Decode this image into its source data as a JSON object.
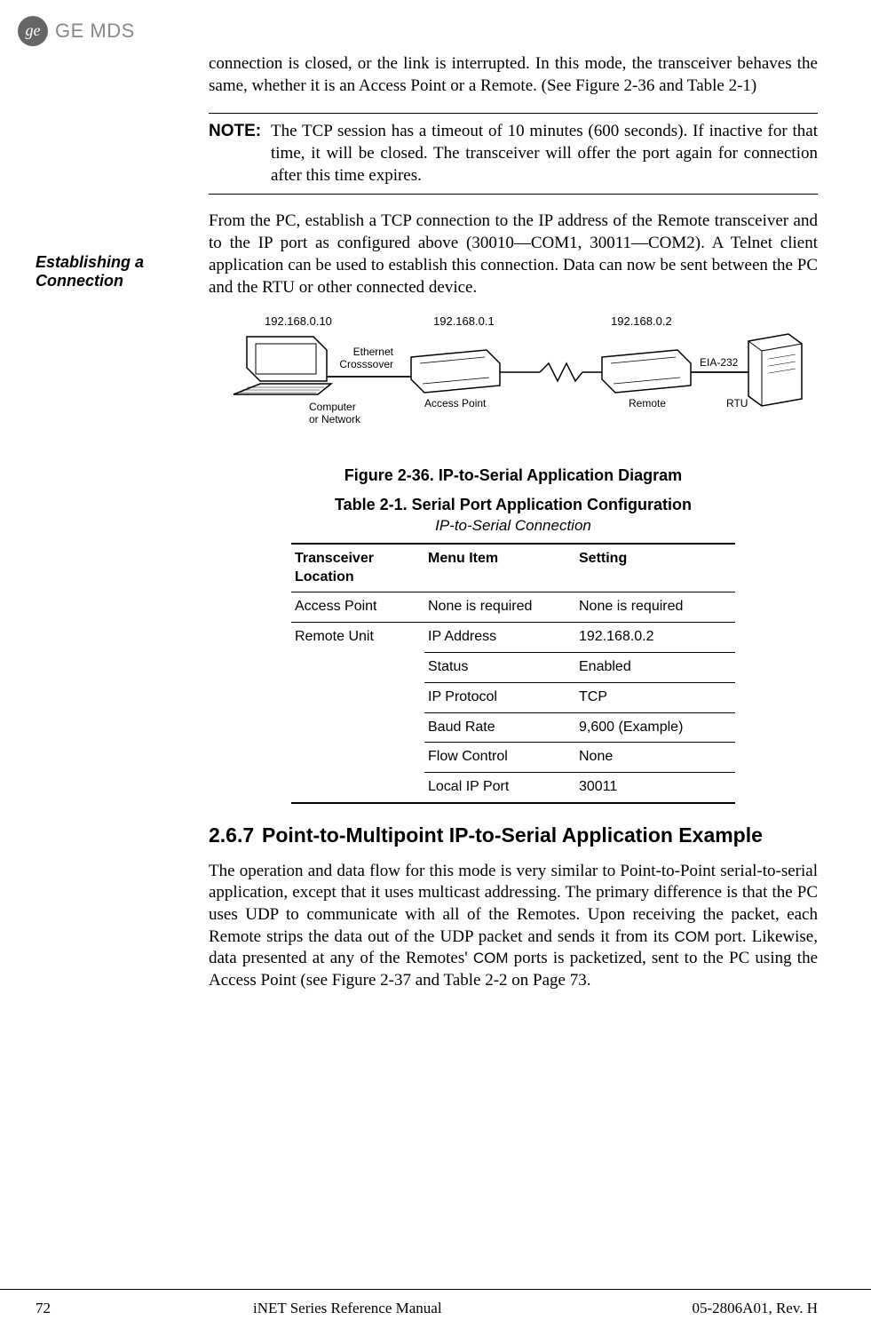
{
  "header": {
    "brand": "GE MDS"
  },
  "sidebar": {
    "margin_heading": "Establishing a Connection"
  },
  "body": {
    "para1": "connection is closed, or the link is interrupted. In this mode, the transceiver behaves the same, whether it is an Access Point or a Remote. (See Figure 2-36 and Table 2-1)",
    "note_label": "NOTE:",
    "note_text": "The TCP session has a timeout of 10 minutes (600 seconds). If inactive for that time, it will be closed. The transceiver will offer the port again for connection after this time expires.",
    "para2": "From the PC, establish a TCP connection to the IP address of the Remote transceiver and to the IP port as configured above (30010—COM1, 30011—COM2). A Telnet client application can be used to establish this connection. Data can now be sent between the PC and the RTU or other connected device."
  },
  "diagram": {
    "ip_pc": "192.168.0.10",
    "ip_ap": "192.168.0.1",
    "ip_remote": "192.168.0.2",
    "label_crossover_l1": "Ethernet",
    "label_crossover_l2": "Crosssover",
    "label_computer_l1": "Computer",
    "label_computer_l2": "or Network",
    "label_ap": "Access Point",
    "label_remote": "Remote",
    "label_eia": "EIA-232",
    "label_rtu": "RTU"
  },
  "figure_caption": "Figure 2-36. IP-to-Serial Application Diagram",
  "table": {
    "title": "Table 2-1. Serial Port Application Configuration",
    "subtitle": "IP-to-Serial Connection",
    "headers": {
      "col1": "Transceiver Location",
      "col2": "Menu Item",
      "col3": "Setting"
    },
    "rows": [
      {
        "c1": "Access Point",
        "c2": "None is required",
        "c3": "None is required"
      },
      {
        "c1": "Remote Unit",
        "c2": "IP Address",
        "c3": "192.168.0.2"
      },
      {
        "c1": "",
        "c2": "Status",
        "c3": "Enabled"
      },
      {
        "c1": "",
        "c2": "IP Protocol",
        "c3": "TCP"
      },
      {
        "c1": "",
        "c2": "Baud Rate",
        "c3": "9,600 (Example)"
      },
      {
        "c1": "",
        "c2": "Flow Control",
        "c3": "None"
      },
      {
        "c1": "",
        "c2": "Local IP Port",
        "c3": "30011"
      }
    ]
  },
  "section": {
    "number": "2.6.7",
    "title": "Point-to-Multipoint IP-to-Serial Application Example",
    "para_a": "The operation and data flow for this mode is very similar to Point-to-Point serial-to-serial application, except that it uses multicast addressing. The primary difference is that the PC uses UDP to communicate with all of the Remotes. Upon receiving the packet, each Remote strips the data out of the UDP packet and sends it from its ",
    "com1": "COM",
    "para_b": " port. Likewise, data presented at any of the Remotes' ",
    "com2": "COM",
    "para_c": " ports is packetized, sent to the PC using the Access Point (see Figure 2-37 and Table 2-2 on Page 73."
  },
  "footer": {
    "page": "72",
    "manual": "iNET Series Reference Manual",
    "docnum": "05-2806A01, Rev. H"
  }
}
